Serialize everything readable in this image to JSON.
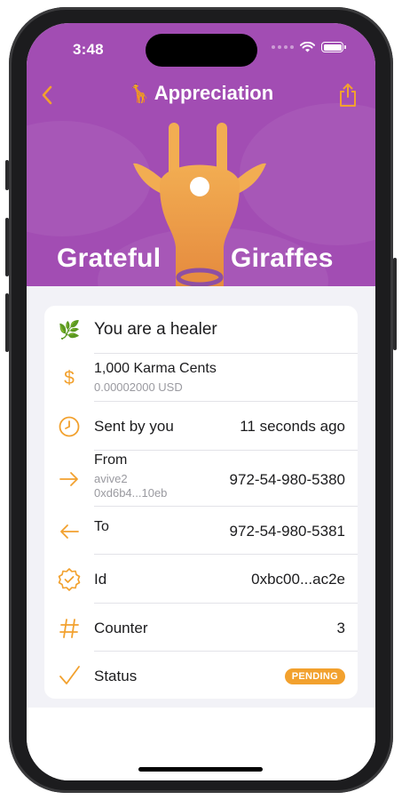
{
  "status_bar": {
    "time": "3:48"
  },
  "nav": {
    "title": "Appreciation",
    "title_emoji": "🦒"
  },
  "hero": {
    "word_left": "Grateful",
    "word_right": "Giraffes"
  },
  "colors": {
    "purple": "#a24db3",
    "accent": "#f2a12e"
  },
  "details": {
    "message": {
      "icon": "leaf-icon",
      "emoji": "🌿",
      "text": "You are a healer"
    },
    "amount": {
      "icon": "dollar-icon",
      "glyph": "$",
      "label": "1,000 Karma Cents",
      "sub": "0.00002000 USD"
    },
    "sent": {
      "icon": "clock-icon",
      "label": "Sent by you",
      "value": "11 seconds ago"
    },
    "from": {
      "icon": "arrow-right-icon",
      "label": "From",
      "sub1": "avive2",
      "sub2": "0xd6b4...10eb",
      "value": "972-54-980-5380"
    },
    "to": {
      "icon": "arrow-left-icon",
      "label": "To",
      "value": "972-54-980-5381"
    },
    "id": {
      "icon": "verified-badge-icon",
      "label": "Id",
      "value": "0xbc00...ac2e"
    },
    "counter": {
      "icon": "hash-icon",
      "label": "Counter",
      "value": "3"
    },
    "status": {
      "icon": "checkmark-icon",
      "label": "Status",
      "badge": "PENDING"
    }
  }
}
